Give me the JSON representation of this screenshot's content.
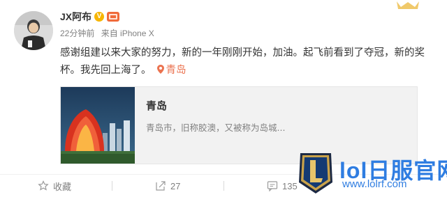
{
  "post": {
    "username": "JX阿布",
    "verified_badge": "V",
    "time": "22分钟前",
    "source": "来自 iPhone X",
    "text": "感谢组建以来大家的努力，新的一年刚刚开始，加油。起飞前看到了夺冠，新的奖杯。我先回上海了。",
    "location_tag": "青岛"
  },
  "location_card": {
    "title": "青岛",
    "description": "青岛市，旧称胶澳，又被称为岛城..."
  },
  "actions": {
    "favorite_label": "收藏",
    "forward_count": "27",
    "comment_count": "135"
  },
  "watermark": {
    "title": "lol日服官网",
    "url": "www.lolrf.com"
  },
  "colors": {
    "accent": "#eb7350",
    "watermark": "#2f7de1",
    "muted": "#808080"
  },
  "icons": [
    "crown-icon",
    "verified-icon",
    "level-icon",
    "location-pin-icon",
    "favorite-icon",
    "forward-icon",
    "comment-icon",
    "lol-logo-icon"
  ]
}
